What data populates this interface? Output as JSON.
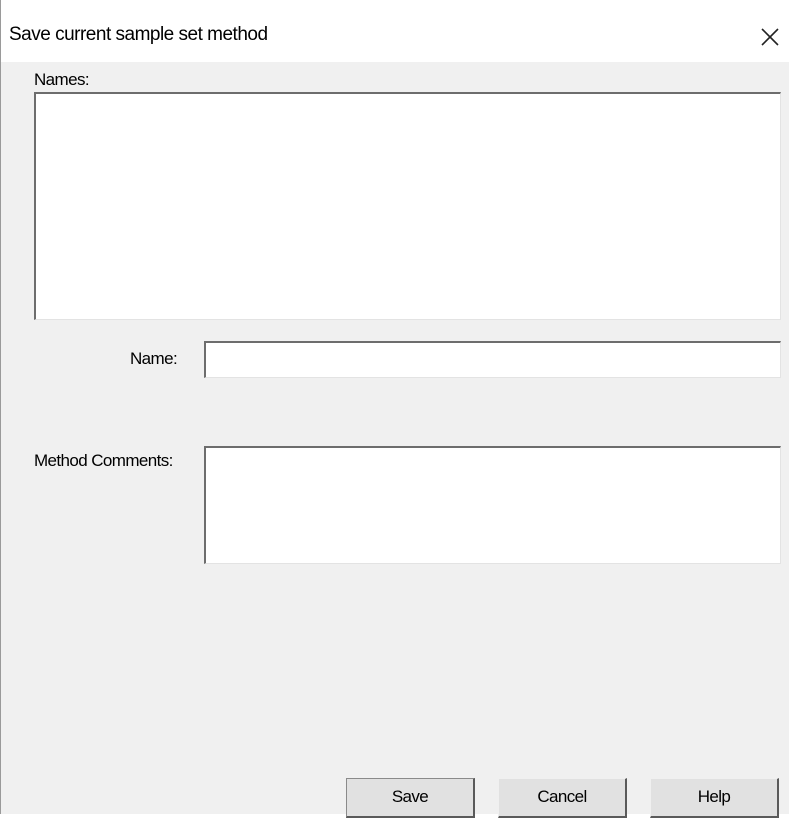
{
  "window": {
    "title": "Save current sample set method",
    "close_icon": "close-icon"
  },
  "names_list": {
    "label": "Names:",
    "items": []
  },
  "name_field": {
    "label": "Name:",
    "value": "",
    "placeholder": ""
  },
  "comments_field": {
    "label": "Method Comments:",
    "value": "",
    "placeholder": ""
  },
  "buttons": {
    "save_label": "Save",
    "cancel_label": "Cancel",
    "help_label": "Help"
  },
  "colors": {
    "dialog_background": "#f0f0f0",
    "field_background": "#ffffff",
    "title_background": "#ffffff"
  }
}
